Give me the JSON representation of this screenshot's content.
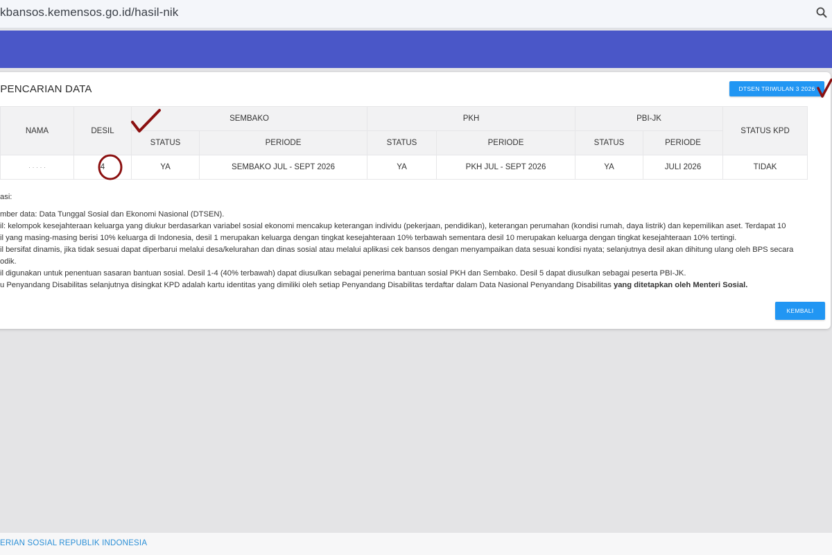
{
  "browser": {
    "url": "kbansos.kemensos.go.id/hasil-nik"
  },
  "card": {
    "title": "L PENCARIAN DATA",
    "dtsen_button": "DTSEN TRIWULAN 3 2026",
    "back_button": "KEMBALI"
  },
  "table": {
    "headers": {
      "nama": "NAMA",
      "desil": "DESIL",
      "sembako": "SEMBAKO",
      "pkh": "PKH",
      "pbijk": "PBI-JK",
      "status_kpd": "STATUS KPD",
      "status": "STATUS",
      "periode": "PERIODE"
    },
    "row": {
      "nama": "·  ·  ·        · ·",
      "desil": "4",
      "sembako_status": "YA",
      "sembako_periode": "SEMBAKO JUL - SEPT 2026",
      "pkh_status": "YA",
      "pkh_periode": "PKH JUL - SEPT 2026",
      "pbijk_status": "YA",
      "pbijk_periode": "JULI 2026",
      "status_kpd": "TIDAK"
    }
  },
  "notes": {
    "heading": "asi:",
    "line1": "mber data: Data Tunggal Sosial dan Ekonomi Nasional (DTSEN).",
    "line2": "il: kelompok kesejahteraan keluarga yang diukur berdasarkan variabel sosial ekonomi mencakup keterangan individu (pekerjaan, pendidikan), keterangan perumahan (kondisi rumah, daya listrik) dan kepemilikan aset. Terdapat 10",
    "line3": "il yang masing-masing berisi 10% keluarga di Indonesia, desil 1 merupakan keluarga dengan tingkat kesejahteraan 10% terbawah sementara desil 10 merupakan keluarga dengan tingkat kesejahteraan 10% tertingi.",
    "line4": "il bersifat dinamis, jika tidak sesuai dapat diperbarui melalui desa/kelurahan dan dinas sosial atau melalui aplikasi cek bansos dengan menyampaikan data sesuai kondisi nyata; selanjutnya desil akan dihitung ulang oleh BPS secara",
    "line5": "odik.",
    "line6": "il digunakan untuk penentuan sasaran bantuan sosial. Desil 1-4 (40% terbawah) dapat diusulkan sebagai penerima bantuan sosial PKH dan Sembako. Desil 5 dapat diusulkan sebagai peserta PBI-JK.",
    "line7_normal": "u Penyandang Disabilitas selanjutnya disingkat KPD adalah kartu identitas yang dimiliki oleh setiap Penyandang Disabilitas terdaftar dalam Data Nasional Penyandang Disabilitas ",
    "line7_bold": "yang ditetapkan oleh Menteri Sosial."
  },
  "footer": {
    "text": "ERIAN SOSIAL REPUBLIK INDONESIA"
  },
  "icons": {
    "url_bar": "search-icon"
  },
  "colors": {
    "navbar": "#4a57c8",
    "button": "#2196f3",
    "footer_link": "#2b8fd6",
    "annotation": "#8b1010"
  }
}
